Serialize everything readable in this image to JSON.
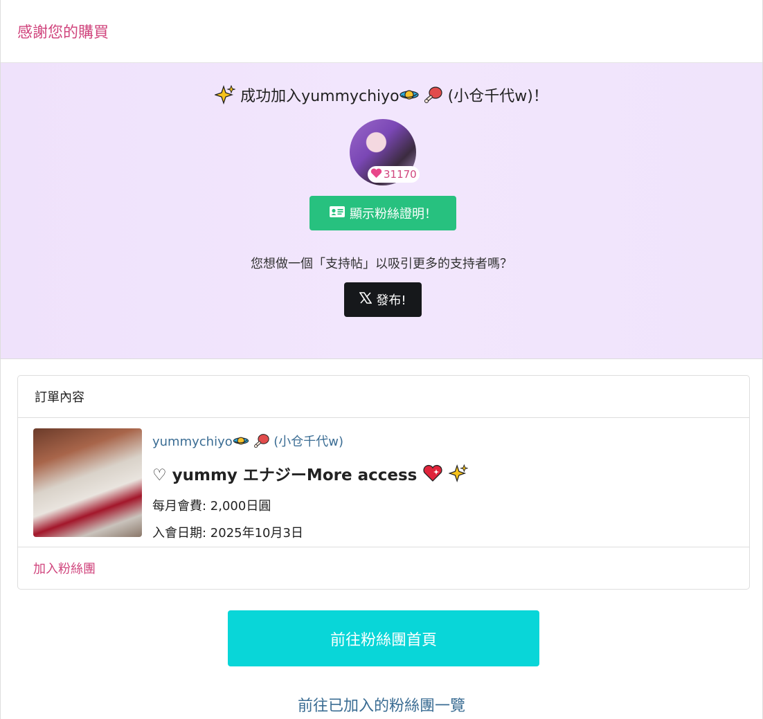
{
  "header": {
    "title": "感謝您的購買"
  },
  "hero": {
    "title_prefix": "成功加入yummychiyo",
    "title_suffix": " (小仓千代w)！",
    "likes": "31170",
    "fan_card_button": "顯示粉絲證明！",
    "question": "您想做一個「支持帖」以吸引更多的支持者嗎？",
    "post_button": "發布!"
  },
  "order": {
    "header": "訂單內容",
    "creator_name": "yummychiyo",
    "creator_alias": " (小仓千代w)",
    "plan_title": "♡ yummy エナジーMore access",
    "monthly_fee": "每月會費: 2,000日圓",
    "join_date": "入會日期: 2025年10月3日",
    "footer_link": "加入粉絲團"
  },
  "actions": {
    "goto_fanclub": "前往粉絲團首頁",
    "goto_list": "前往已加入的粉絲團一覽"
  },
  "colors": {
    "accent_pink": "#d0457d",
    "hero_bg": "#f0e4fb",
    "green": "#27c17f",
    "cyan": "#09d6d8",
    "link_blue": "#3a6c93"
  },
  "icons": [
    "sparkle-icon",
    "planet-icon",
    "meat-icon",
    "heart-icon",
    "id-card-icon",
    "x-logo-icon",
    "sparkling-heart-icon"
  ]
}
